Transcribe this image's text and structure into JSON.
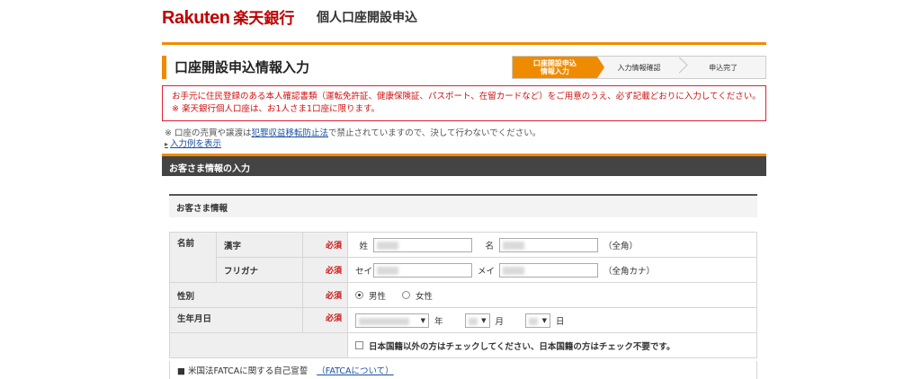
{
  "header": {
    "logo_rakuten": "Rakuten",
    "logo_bank": "楽天銀行",
    "site_title": "個人口座開設申込"
  },
  "page": {
    "title": "口座開設申込情報入力"
  },
  "steps": [
    {
      "label": "口座開設申込\n情報入力",
      "active": true
    },
    {
      "label": "入力情報確認",
      "active": false
    },
    {
      "label": "申込完了",
      "active": false
    }
  ],
  "alert": {
    "line1": "お手元に住民登録のある本人確認書類（運転免許証、健康保険証、パスポート、在留カードなど）をご用意のうえ、必ず記載どおりに入力してください。",
    "line2": "※ 楽天銀行個人口座は、お1人さま1口座に限ります。"
  },
  "notice": {
    "prefix": "※ 口座の売買や譲渡は",
    "link": "犯罪収益移転防止法",
    "suffix": "で禁止されていますので、決して行わないでください。",
    "example_link": "入力例を表示"
  },
  "section": {
    "title": "お客さま情報の入力",
    "subpanel": "お客さま情報"
  },
  "form": {
    "required_label": "必須",
    "name": {
      "label": "名前",
      "kanji_label": "漢字",
      "kana_label": "フリガナ",
      "sei_label": "姓",
      "mei_label": "名",
      "sei_kana_label": "セイ",
      "mei_kana_label": "メイ",
      "kanji_note": "（全角）",
      "kana_note": "（全角カナ）"
    },
    "gender": {
      "label": "性別",
      "male": "男性",
      "female": "女性",
      "selected": "male"
    },
    "birthdate": {
      "label": "生年月日",
      "year_unit": "年",
      "month_unit": "月",
      "day_unit": "日"
    },
    "nationality_check": "日本国籍以外の方はチェックしてください、日本国籍の方はチェック不要です。",
    "fatca": {
      "label": "■ 米国法FATCAに関する自己宣誓",
      "link": "（FATCAについて）"
    }
  }
}
